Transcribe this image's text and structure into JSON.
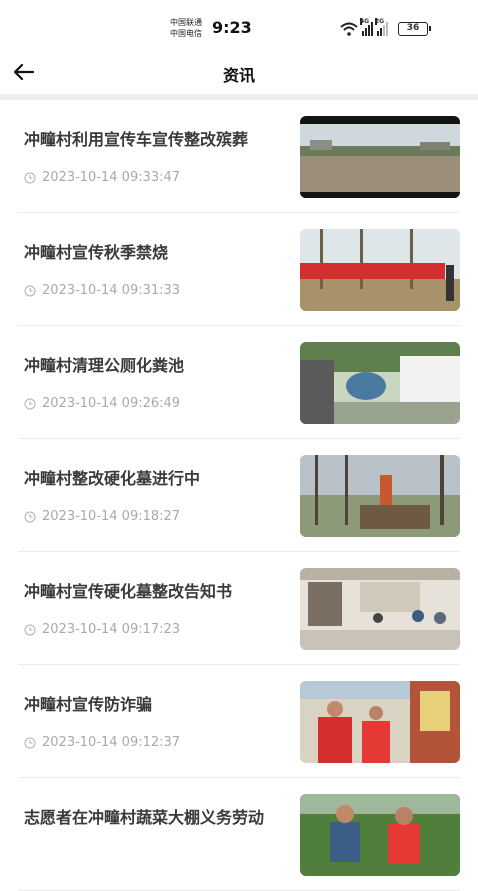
{
  "status_bar": {
    "carrier_1": "中国联通",
    "carrier_2": "中国电信",
    "time": "9:23",
    "signal_1_gen": "4G",
    "signal_2_gen": "2G",
    "battery": "36"
  },
  "nav": {
    "back_icon": "arrow-left-icon",
    "title": "资讯"
  },
  "news": [
    {
      "title": "冲疃村利用宣传车宣传整改殡葬",
      "time": "2023-10-14 09:33:47",
      "image": "village-road-photo"
    },
    {
      "title": "冲疃村宣传秋季禁烧",
      "time": "2023-10-14 09:31:33",
      "image": "red-banner-trees-photo"
    },
    {
      "title": "冲疃村清理公厕化粪池",
      "time": "2023-10-14 09:26:49",
      "image": "septic-truck-photo"
    },
    {
      "title": "冲疃村整改硬化墓进行中",
      "time": "2023-10-14 09:18:27",
      "image": "excavator-trees-photo"
    },
    {
      "title": "冲疃村宣传硬化墓整改告知书",
      "time": "2023-10-14 09:17:23",
      "image": "villagers-seated-photo"
    },
    {
      "title": "冲疃村宣传防诈骗",
      "time": "2023-10-14 09:12:37",
      "image": "volunteers-red-vests-photo"
    },
    {
      "title": "志愿者在冲疃村蔬菜大棚义务劳动",
      "time": "",
      "image": "greenhouse-volunteers-photo"
    }
  ]
}
